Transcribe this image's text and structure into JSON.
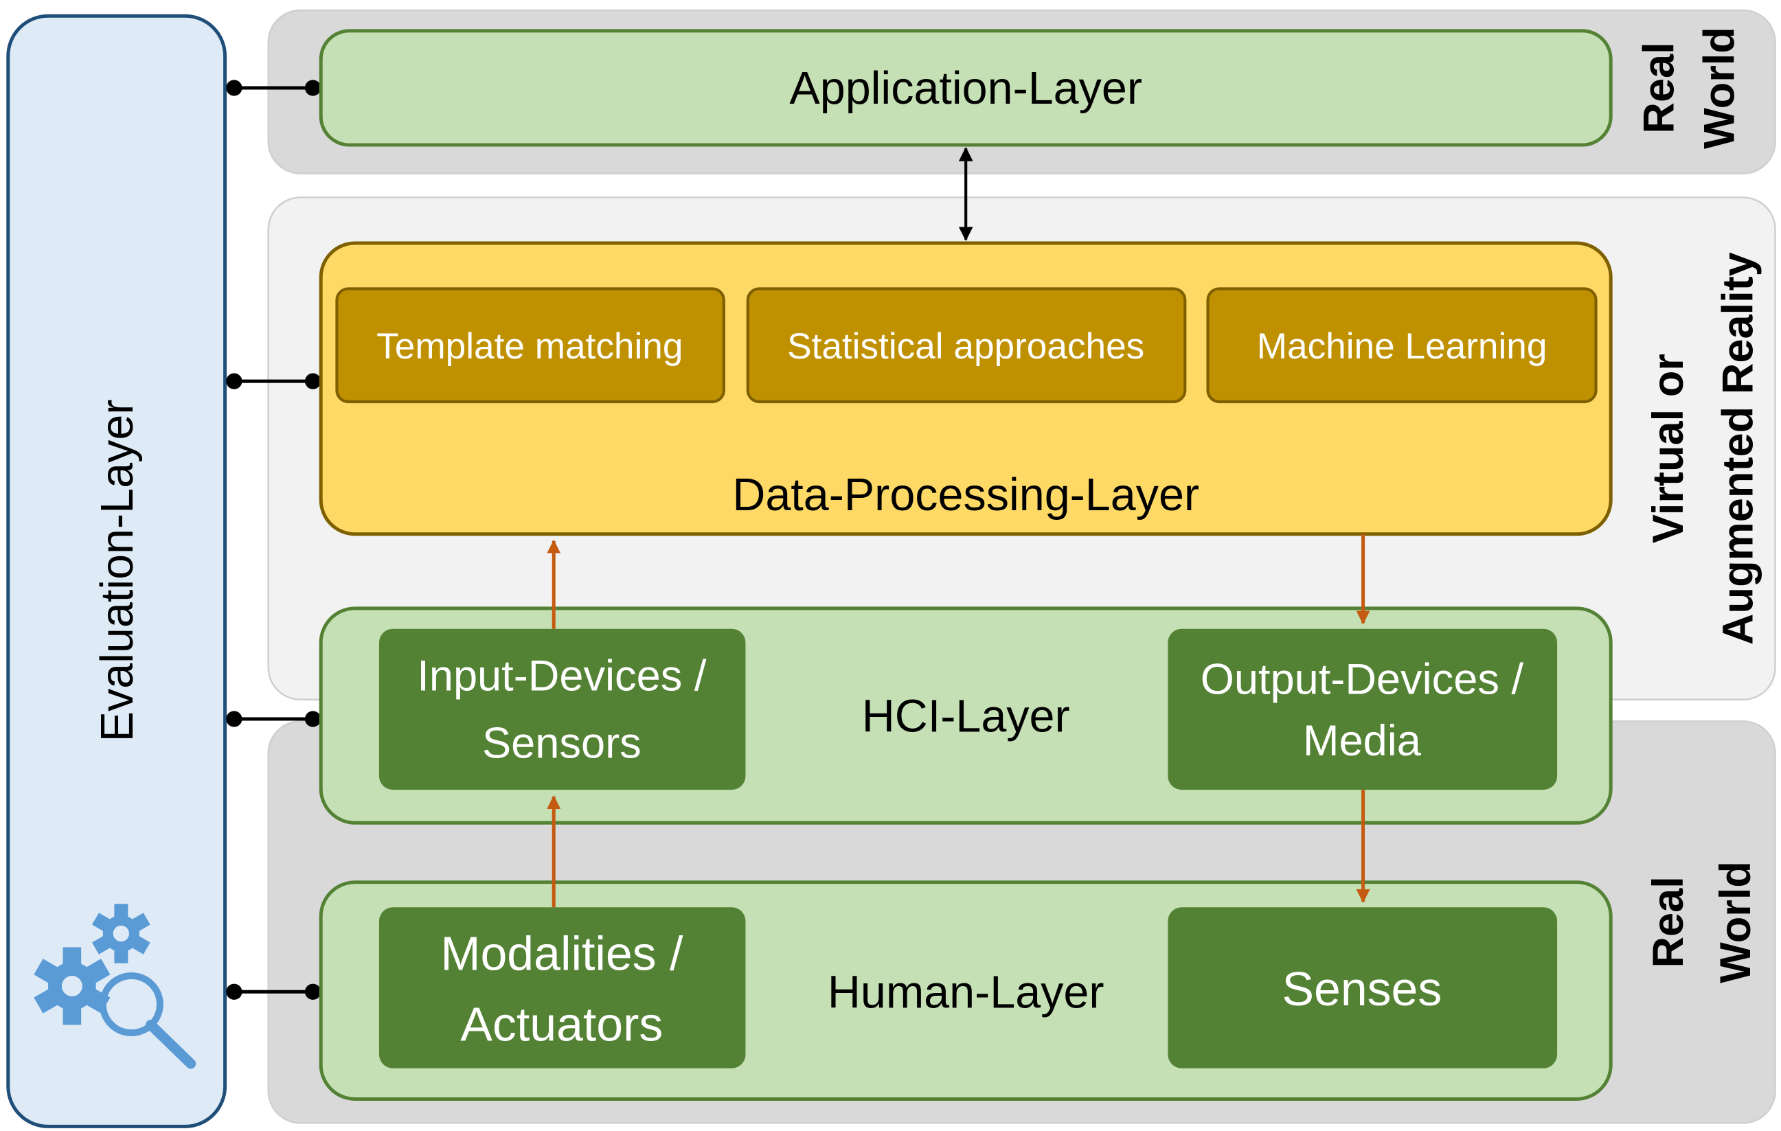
{
  "evaluation_layer": {
    "label": "Evaluation-Layer",
    "icon": "gears-magnifier-icon"
  },
  "zones": {
    "top_real_world": {
      "line1": "Real",
      "line2": "World"
    },
    "virtual": {
      "line1": "Virtual or",
      "line2": "Augmented Reality"
    },
    "bottom_real_world": {
      "line1": "Real",
      "line2": "World"
    }
  },
  "layers": {
    "application": {
      "label": "Application-Layer"
    },
    "data_processing": {
      "label": "Data-Processing-Layer",
      "methods": [
        "Template matching",
        "Statistical approaches",
        "Machine Learning"
      ]
    },
    "hci": {
      "label": "HCI-Layer",
      "input": {
        "line1": "Input-Devices /",
        "line2": "Sensors"
      },
      "output": {
        "line1": "Output-Devices /",
        "line2": "Media"
      }
    },
    "human": {
      "label": "Human-Layer",
      "actuators": {
        "line1": "Modalities /",
        "line2": "Actuators"
      },
      "senses": {
        "label": "Senses"
      }
    }
  },
  "colors": {
    "eval_fill": "#deebf7",
    "eval_border": "#1f4e79",
    "real_world_bg": "#d9d9d9",
    "virtual_bg": "#f2f2f2",
    "green_light": "#c5e0b4",
    "green_border": "#548235",
    "green_dark": "#548235",
    "yellow": "#ffd966",
    "yellow_border": "#7f6000",
    "gold": "#bf9000",
    "arrow_orange": "#c55a11",
    "icon_blue": "#5b9bd5"
  }
}
